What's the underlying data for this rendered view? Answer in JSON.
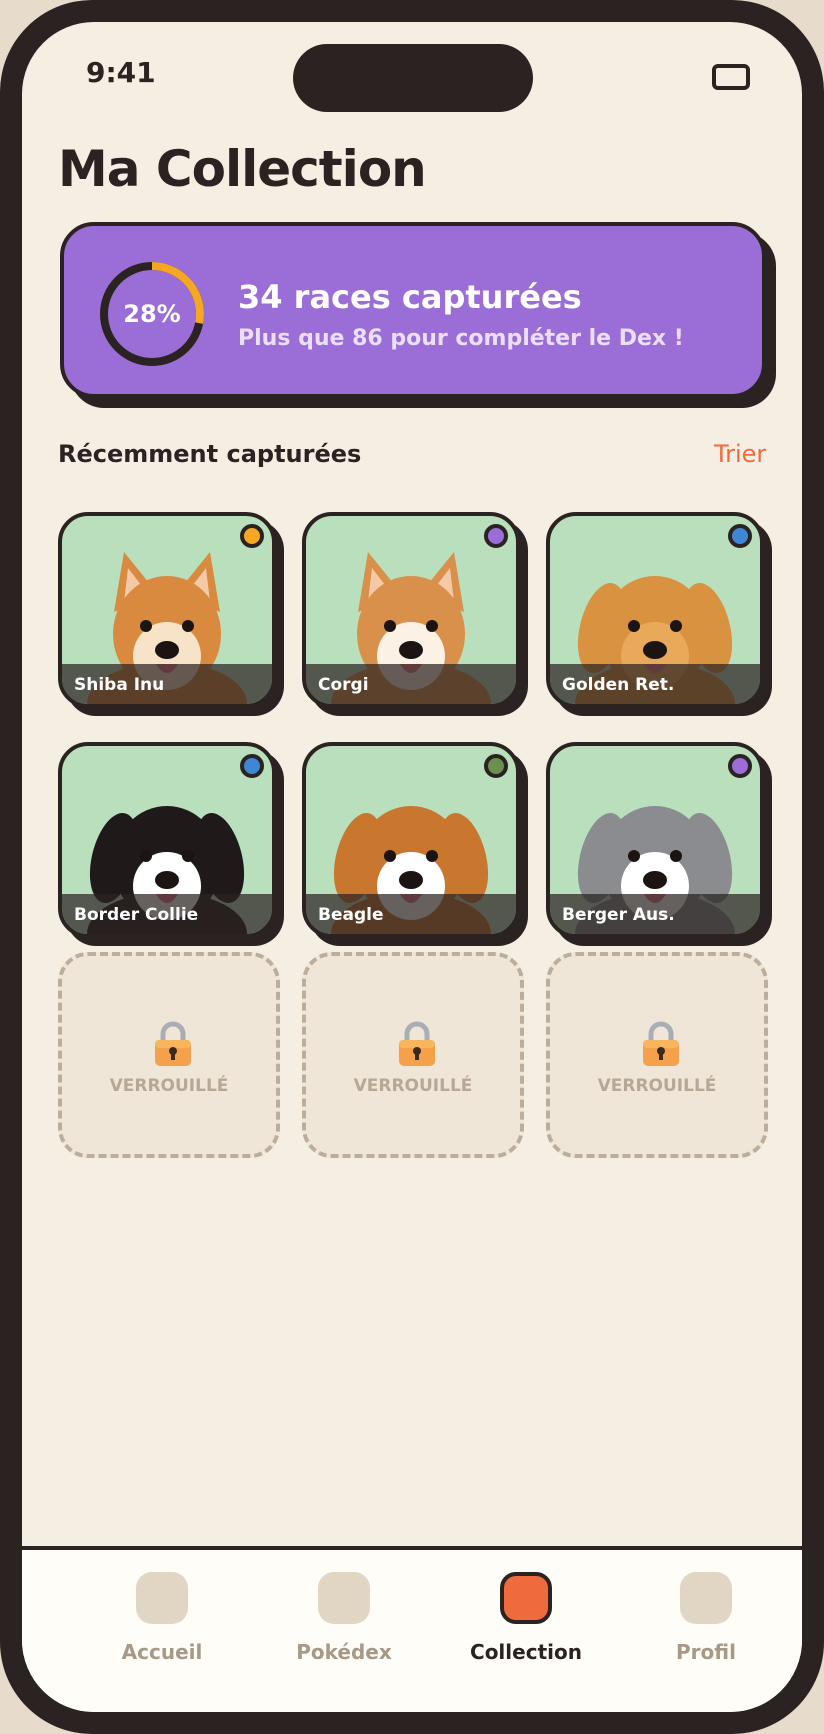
{
  "status_bar": {
    "time": "9:41"
  },
  "page": {
    "title": "Ma Collection"
  },
  "progress_card": {
    "percent_label": "28%",
    "percent_value": 28,
    "headline": "34 races capturées",
    "subtitle": "Plus que 86 pour compléter le Dex !",
    "ring_color": "#f5a623"
  },
  "recent_section": {
    "title": "Récemment capturées",
    "sort_label": "Trier"
  },
  "dogs": [
    {
      "name": "Shiba Inu",
      "rarity_color": "#f5a623",
      "fur": "#d98a3f",
      "face": "#f7e3c8",
      "ears": "pointy"
    },
    {
      "name": "Corgi",
      "rarity_color": "#9b6dd6",
      "fur": "#d9904a",
      "face": "#fbf1e4",
      "ears": "pointy"
    },
    {
      "name": "Golden Ret.",
      "rarity_color": "#3f86d4",
      "fur": "#d9923f",
      "face": "#e8a95a",
      "ears": "floppy"
    },
    {
      "name": "Border Collie",
      "rarity_color": "#3f86d4",
      "fur": "#1f1a19",
      "face": "#ffffff",
      "ears": "floppy"
    },
    {
      "name": "Beagle",
      "rarity_color": "#6b8f4e",
      "fur": "#c9772f",
      "face": "#ffffff",
      "ears": "floppy"
    },
    {
      "name": "Berger Aus.",
      "rarity_color": "#9b6dd6",
      "fur": "#8a8c90",
      "face": "#ffffff",
      "ears": "floppy"
    }
  ],
  "locked_slots": [
    {
      "label": "VERROUILLÉ"
    },
    {
      "label": "VERROUILLÉ"
    },
    {
      "label": "VERROUILLÉ"
    }
  ],
  "tabs": [
    {
      "label": "Accueil",
      "active": false
    },
    {
      "label": "Pokédex",
      "active": false
    },
    {
      "label": "Collection",
      "active": true
    },
    {
      "label": "Profil",
      "active": false
    }
  ]
}
